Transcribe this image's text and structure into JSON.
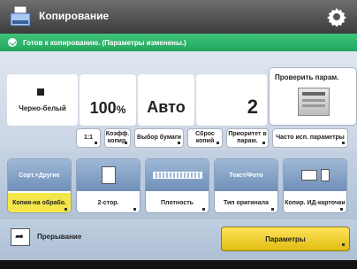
{
  "window": {
    "title": "Копирование"
  },
  "status": {
    "message": "Готов к копированию. (Параметры изменены.)"
  },
  "main": {
    "color_mode": "Черно-белый",
    "ratio": "100",
    "ratio_unit": "%",
    "paper": "Авто",
    "copies": "2",
    "preview": "Проверить парам."
  },
  "sub_buttons": [
    {
      "label": "1:1"
    },
    {
      "label": "Коэфф. копир."
    },
    {
      "label": "Выбор бумаги"
    },
    {
      "label": "Сброс копий"
    },
    {
      "label": "Приоритет в парам."
    },
    {
      "label": "Часто исп. параметры"
    }
  ],
  "functions": [
    {
      "top": "Сорт.+Другие",
      "bottom": "Копия-на обрабо.",
      "highlight": true
    },
    {
      "top": "",
      "bottom": "2-стор."
    },
    {
      "top": "",
      "bottom": "Плотность"
    },
    {
      "top": "Текст/Фото",
      "bottom": "Тип оригинала"
    },
    {
      "top": "",
      "bottom": "Копир. ИД-карточки"
    }
  ],
  "bottom": {
    "interrupt_label": "Прерывание",
    "params_label": "Параметры"
  },
  "colors": {
    "status_green": "#2aa866",
    "highlight_yellow": "#f3e64a",
    "function_blue": "#7a98c0"
  },
  "icons": [
    "copy-app-icon",
    "gear-icon",
    "status-check-icon",
    "preview-icon",
    "interrupt-icon"
  ]
}
